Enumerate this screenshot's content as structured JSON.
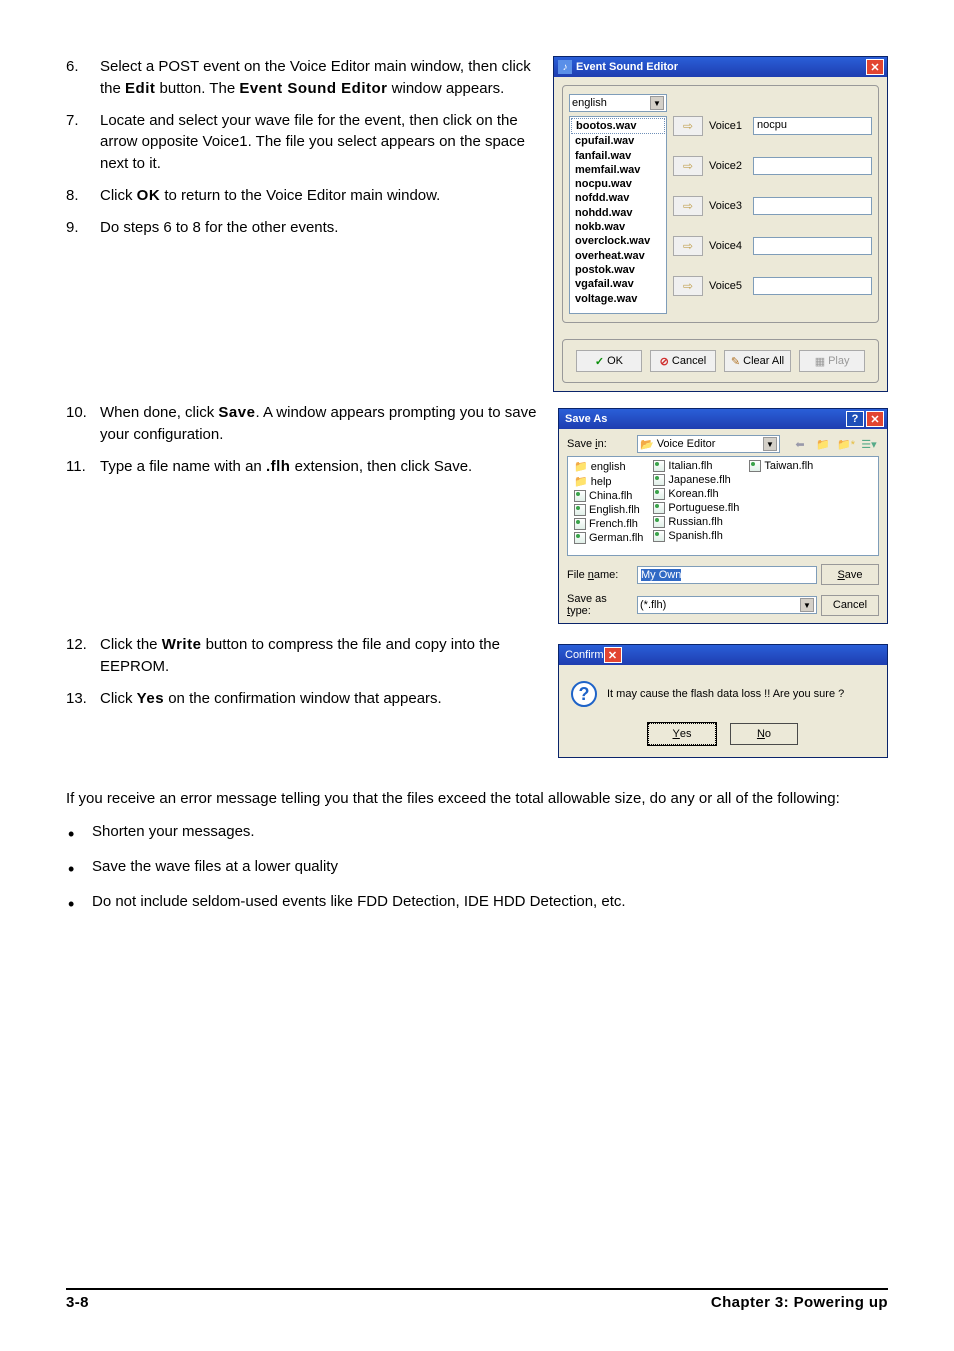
{
  "steps": {
    "s6": {
      "num": "6.",
      "text_before": "Select a POST event on the Voice Editor main window, then click the ",
      "bold1": "Edit",
      "text_mid": " button. The ",
      "bold2": "Event Sound Editor",
      "text_after": " window appears."
    },
    "s7": {
      "num": "7.",
      "text": "Locate and select your wave file for the event, then click on the arrow opposite Voice1. The file you select appears on the space next to it."
    },
    "s8": {
      "num": "8.",
      "text_before": "Click ",
      "bold1": "OK",
      "text_after": " to return to the Voice Editor main window."
    },
    "s9": {
      "num": "9.",
      "text": "Do steps 6 to 8 for the other events."
    },
    "s10": {
      "num": "10.",
      "text_before": "When done, click ",
      "bold1": "Save",
      "text_after": ". A window appears prompting you to save your configuration."
    },
    "s11": {
      "num": "11.",
      "text_before": "Type a file name with an ",
      "bold1": ".flh",
      "text_after": " extension, then click Save."
    },
    "s12": {
      "num": "12.",
      "text_before": "Click the ",
      "bold1": "Write",
      "text_after": " button to compress the file and copy into the EEPROM."
    },
    "s13": {
      "num": "13.",
      "text_before": "Click ",
      "bold1": "Yes",
      "text_after": " on the confirmation window that appears."
    }
  },
  "error_para": "If you receive an error message telling you that the files exceed the total allowable size, do any or all of the following:",
  "bullets": {
    "b1": "Shorten your messages.",
    "b2": "Save the wave files at a lower quality",
    "b3": "Do not include seldom-used events like FDD Detection, IDE HDD Detection, etc."
  },
  "footer": {
    "left": "3-8",
    "right": "Chapter 3: Powering up"
  },
  "ese": {
    "title": "Event Sound Editor",
    "combo": "english",
    "items": {
      "i0": "bootos.wav",
      "i1": "cpufail.wav",
      "i2": "fanfail.wav",
      "i3": "memfail.wav",
      "i4": "nocpu.wav",
      "i5": "nofdd.wav",
      "i6": "nohdd.wav",
      "i7": "nokb.wav",
      "i8": "overclock.wav",
      "i9": "overheat.wav",
      "i10": "postok.wav",
      "i11": "vgafail.wav",
      "i12": "voltage.wav"
    },
    "voice": {
      "v1": "Voice1",
      "v2": "Voice2",
      "v3": "Voice3",
      "v4": "Voice4",
      "v5": "Voice5"
    },
    "voice1_value": "nocpu",
    "btn": {
      "ok": "OK",
      "cancel": "Cancel",
      "clear": "Clear All",
      "play": "Play"
    }
  },
  "saveas": {
    "title": "Save As",
    "savein_label": "Save in:",
    "savein_value": "Voice Editor",
    "files": {
      "c1": {
        "f0": "english",
        "f1": "help",
        "f2": "China.flh",
        "f3": "English.flh",
        "f4": "French.flh",
        "f5": "German.flh"
      },
      "c2": {
        "f0": "Italian.flh",
        "f1": "Japanese.flh",
        "f2": "Korean.flh",
        "f3": "Portuguese.flh",
        "f4": "Russian.flh",
        "f5": "Spanish.flh"
      },
      "c3": {
        "f0": "Taiwan.flh"
      }
    },
    "filename_label": "File name:",
    "filename_value": "My Own",
    "saveastype_label": "Save as type:",
    "saveastype_value": "(*.flh)",
    "btn": {
      "save": "Save",
      "cancel": "Cancel"
    }
  },
  "confirm": {
    "title": "Confirm",
    "message": "It may cause the flash data loss !!  Are you sure ?",
    "yes": "Yes",
    "no": "No"
  }
}
